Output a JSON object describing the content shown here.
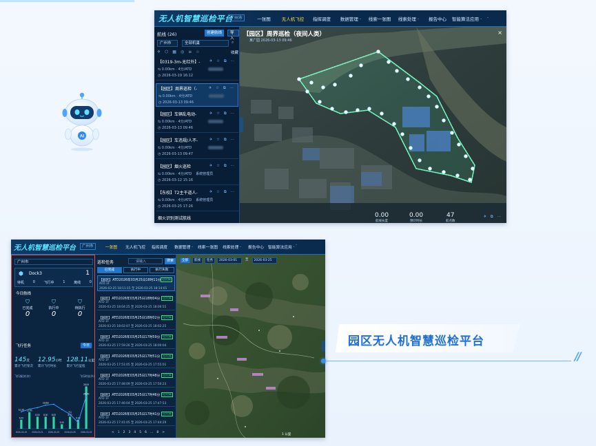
{
  "shot1": {
    "header": {
      "title": "无人机智慧巡检平台",
      "city": "广州市",
      "nav": [
        "一张图",
        "无人机飞控",
        "指挥调度",
        "数据管理 ·",
        "线索一张图",
        "线索处理 ·",
        "报告中心",
        "智能算法应用 ·",
        "·"
      ],
      "active_index": 1
    },
    "sidebar": {
      "title": "航线 (26)",
      "create_button": "创建航线",
      "import_button": "导入",
      "city_filter": "广州市",
      "org_filter": "全部机巢",
      "favorite_label": "收藏",
      "items": [
        {
          "name": "【0319-3m-无红外】-",
          "meta": "0.00km · 4分/ATD",
          "time": "2026-03-19 16:12"
        },
        {
          "name": "【园区】周界巡检（-",
          "meta": "0.00km · 4分/ATD",
          "time": "2026-03-13 09:46"
        },
        {
          "name": "【园区】车辆乱电动-",
          "meta": "0.00km · 4分/ATD",
          "time": "2026-03-13 09:46"
        },
        {
          "name": "【园区】车违规/人不-",
          "meta": "0.00km · 4分/ATD",
          "time": "2026-03-13 09:47"
        },
        {
          "name": "【园区】烟火巡检",
          "meta": "0.00km · 4分/ATD",
          "extra": "系统管理员",
          "time": "2026-03-12 15:16"
        },
        {
          "name": "【东校】T2主干道人-",
          "meta": "0.00km · 4分/ATD",
          "extra": "系统管理员",
          "time": "2026-03-25 17:26"
        }
      ],
      "last_item": "烟火识别测试航线"
    },
    "map": {
      "title": "【园区】周界巡检（夜间人类）",
      "subtitle": "某广园   2026-03-13 09:46",
      "back": "×",
      "stats": [
        {
          "value": "0.00",
          "label": "航线长度"
        },
        {
          "value": "0.00",
          "label": "预计时长"
        },
        {
          "value": "47",
          "label": "航点数"
        }
      ]
    }
  },
  "shot2": {
    "header": {
      "title": "无人机智慧巡检平台",
      "city": "广州市",
      "nav": [
        "一张图",
        "无人机飞控",
        "指挥调度",
        "数据管理 ·",
        "线索一张图",
        "线索处理 ·",
        "报告中心",
        "智能算法应用 ·",
        "·"
      ],
      "active_index": 0
    },
    "left": {
      "city_select": "广州市",
      "dock_name": "Dock3",
      "dock_count": "1",
      "status": [
        "待机",
        "0",
        "飞行中",
        "1",
        "离线",
        "0"
      ],
      "section_today": "今日航线",
      "tasks": [
        {
          "label": "已完成",
          "value": "0"
        },
        {
          "label": "执行中",
          "value": "0"
        },
        {
          "label": "待执行",
          "value": "0"
        }
      ],
      "section_summary": "飞行任务",
      "today_btn": "今日",
      "stats": [
        {
          "value": "145",
          "unit": "次",
          "label": "累计飞行架次"
        },
        {
          "value": "12.95",
          "unit": "小时",
          "label": "累计飞行时长"
        },
        {
          "value": "128.11",
          "unit": "公里",
          "label": "累计飞行里程"
        }
      ],
      "chart_left_label": "飞行架次(次)",
      "chart_right_label": "飞行时长(h)"
    },
    "middle": {
      "title": "巡检任务",
      "search_placeholder": "请输入",
      "search_button": "搜索",
      "tabs": [
        "已完成",
        "执行中",
        "执行失败"
      ],
      "tasks": [
        {
          "title": "【园区】ATD2026年03月25日18时11分",
          "badge": "已完成",
          "d1": "ATD  1F",
          "d2": "2026-03-25 18:11:15 至 2026-03-25 18:14:01"
        },
        {
          "title": "【园区】ATD2026年03月25日18时04分",
          "badge": "已完成",
          "d1": "ATD  1F",
          "d2": "2026-03-25 18:04:25 至 2026-03-25 18:06:55"
        },
        {
          "title": "【园区】ATD2026年03月25日18时02分",
          "badge": "已完成",
          "d1": "ATD  1F",
          "d2": "2026-03-25 18:02:07 至 2026-03-25 18:02:25"
        },
        {
          "title": "【园区】ATD2026年03月25日17时59分",
          "badge": "已完成",
          "d1": "ATD  1F",
          "d2": "2026-03-25 17:59:26 至 2026-03-25 18:00:04"
        },
        {
          "title": "【园区】ATD2026年03月25日17时51分",
          "badge": "已完成",
          "d1": "ATD  1F",
          "d2": "2026-03-25 17:51:05 至 2026-03-25 17:55:01"
        },
        {
          "title": "【园区】ATD2026年03月25日17时48分",
          "badge": "已完成",
          "d1": "ATD  1F",
          "d2": "2026-03-25 17:48:09 至 2026-03-25 17:50:23"
        },
        {
          "title": "【园区】ATD2026年03月25日17时46分",
          "badge": "已完成",
          "d1": "ATD  1F",
          "d2": "2026-03-25 17:46:04 至 2026-03-25 17:47:53"
        },
        {
          "title": "【园区】ATD2026年03月25日17时41分",
          "badge": "已完成",
          "d1": "ATD  1F",
          "d2": "2026-03-25 17:41:05 至 2026-03-25 17:44:29"
        }
      ],
      "pager": [
        "<",
        "1",
        "2",
        "3",
        "4",
        "5",
        "6",
        "...",
        "8",
        ">"
      ]
    },
    "map": {
      "bar": [
        "全部",
        "航线",
        "任务",
        "2026-03-01",
        "至",
        "2026-03-25"
      ],
      "scale": "1 公里"
    }
  },
  "chart_data": {
    "type": "bar",
    "categories": [
      "2026-03-19",
      "",
      "2026-03-21",
      "",
      "2026-03-23",
      "",
      "2026-03-25",
      "",
      "2026-03-19"
    ],
    "series": [
      {
        "values": [
          6,
          11,
          8,
          8,
          8,
          3,
          8,
          6,
          28
        ]
      },
      {
        "values": [
          11.2,
          13.0,
          14.0,
          15.6,
          16.2,
          12.8,
          9.6,
          4.1,
          21.6
        ]
      }
    ],
    "data_labels": [
      "11.22",
      "",
      "",
      "13.63",
      "",
      "",
      "7.1",
      "",
      "20.00"
    ],
    "bar_labels": [
      "6.00",
      "11.00",
      "8.00",
      "8.00",
      "8.00",
      "3.00",
      "8.42",
      "6.00",
      "28.00"
    ],
    "ylim": [
      0,
      30
    ]
  },
  "caption": {
    "text": "园区无人机智慧巡检平台"
  },
  "colors": {
    "brand": "#1f6fd6",
    "accent": "#5ce2ff",
    "panel": "#0b2440",
    "success": "#3ee07a"
  }
}
